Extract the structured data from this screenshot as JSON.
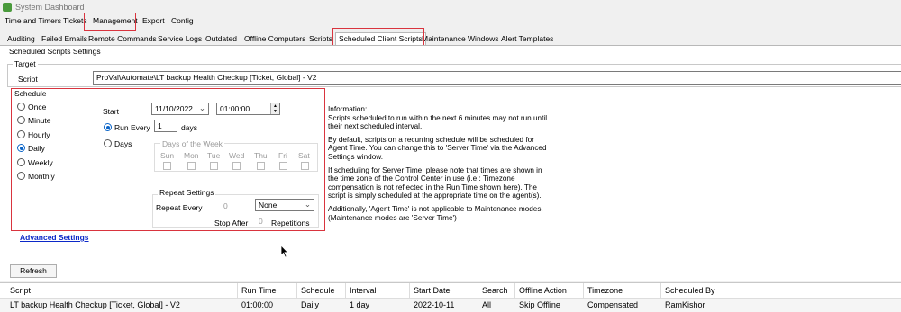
{
  "window": {
    "title": "System Dashboard"
  },
  "menu": {
    "items": [
      "Time and Timers",
      "Tickets",
      "Management",
      "Export",
      "Config"
    ],
    "selected": "Management"
  },
  "tabs": {
    "items": [
      "Auditing",
      "Failed Emails",
      "Remote Commands",
      "Service Logs",
      "Outdated",
      "Offline Computers",
      "Scripts",
      "Scheduled Client Scripts",
      "Maintenance Windows",
      "Alert Templates"
    ],
    "active": "Scheduled Client Scripts"
  },
  "settings": {
    "title": "Scheduled Scripts Settings",
    "target_label": "Target",
    "script_label": "Script",
    "script_value": "ProVal\\Automate\\LT backup Health Checkup [Ticket, Global] - V2"
  },
  "schedule": {
    "title": "Schedule",
    "options": [
      "Once",
      "Minute",
      "Hourly",
      "Daily",
      "Weekly",
      "Monthly"
    ],
    "selected": "Daily",
    "start_label": "Start",
    "start_date": "11/10/2022",
    "start_time": "01:00:00",
    "run_every_label": "Run Every",
    "run_every_value": "1",
    "run_every_unit": "days",
    "days_label": "Days",
    "days_of_week": {
      "title": "Days of the Week",
      "days": [
        "Sun",
        "Mon",
        "Tue",
        "Wed",
        "Thu",
        "Fri",
        "Sat"
      ]
    },
    "repeat": {
      "title": "Repeat Settings",
      "repeat_every_label": "Repeat Every",
      "repeat_every_value": "0",
      "repeat_unit": "None",
      "stop_after_label": "Stop After",
      "stop_after_value": "0",
      "repetitions_label": "Repetitions"
    }
  },
  "info": {
    "title": "Information:",
    "paragraphs": [
      "Scripts scheduled to run within the next 6 minutes may not run until\ntheir next scheduled interval.",
      "By default, scripts on a recurring schedule will be scheduled for\nAgent Time. You can change this to 'Server Time' via the Advanced\nSettings window.",
      "If scheduling for Server Time, please note that times are shown in\nthe time zone of the Control Center in use (i.e.: Timezone\ncompensation is not reflected in the Run Time shown here). The\nscript is simply scheduled at the appropriate time on the agent(s).",
      "Additionally, 'Agent Time' is not applicable to Maintenance modes.\n(Maintenance modes are 'Server Time')"
    ]
  },
  "advanced_link": "Advanced Settings",
  "refresh_button": "Refresh",
  "grid": {
    "columns": [
      "Script",
      "Run Time",
      "Schedule",
      "Interval",
      "Start Date",
      "Search",
      "Offline Action",
      "Timezone",
      "Scheduled By"
    ],
    "rows": [
      [
        "LT backup Health Checkup [Ticket, Global] - V2",
        "01:00:00",
        "Daily",
        "1 day",
        "2022-10-11",
        "All",
        "Skip Offline",
        "Compensated",
        "RamKishor"
      ]
    ]
  },
  "colors": {
    "highlight": "#d9343e",
    "link": "#0b28c8",
    "radio_selected": "#0a64c8"
  }
}
